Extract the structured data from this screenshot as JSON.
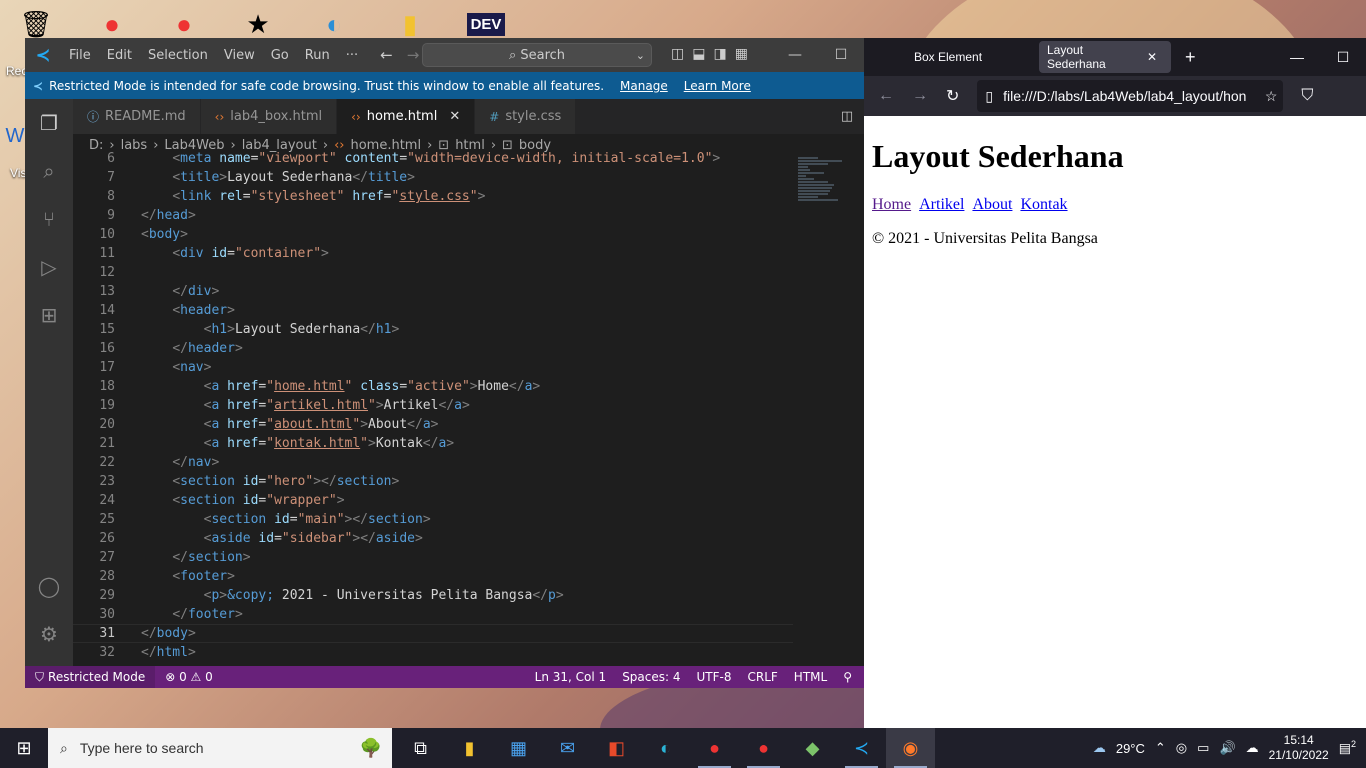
{
  "desktop": {
    "recycle_label": "Rec",
    "vs_label": "Vis"
  },
  "vscode": {
    "menu": [
      "File",
      "Edit",
      "Selection",
      "View",
      "Go",
      "Run",
      "···"
    ],
    "search_placeholder": "Search",
    "banner_text": "Restricted Mode is intended for safe code browsing. Trust this window to enable all features.",
    "banner_manage": "Manage",
    "banner_learn": "Learn More",
    "tabs": [
      {
        "label": "README.md",
        "icon": "info-icon"
      },
      {
        "label": "lab4_box.html",
        "icon": "html-icon"
      },
      {
        "label": "home.html",
        "icon": "html-icon",
        "active": true
      },
      {
        "label": "style.css",
        "icon": "css-icon"
      }
    ],
    "breadcrumb": [
      "D:",
      "labs",
      "Lab4Web",
      "lab4_layout",
      "home.html",
      "html",
      "body"
    ],
    "lines": [
      {
        "n": "6",
        "code": "    <meta name=\"viewport\" content=\"width=device-width, initial-scale=1.0\">"
      },
      {
        "n": "7",
        "code": "    <title>Layout Sederhana</title>"
      },
      {
        "n": "8",
        "code": "    <link rel=\"stylesheet\" href=\"style.css\">"
      },
      {
        "n": "9",
        "code": "</head>"
      },
      {
        "n": "10",
        "code": "<body>"
      },
      {
        "n": "11",
        "code": "    <div id=\"container\">"
      },
      {
        "n": "12",
        "code": ""
      },
      {
        "n": "13",
        "code": "    </div>"
      },
      {
        "n": "14",
        "code": "    <header>"
      },
      {
        "n": "15",
        "code": "        <h1>Layout Sederhana</h1>"
      },
      {
        "n": "16",
        "code": "    </header>"
      },
      {
        "n": "17",
        "code": "    <nav>"
      },
      {
        "n": "18",
        "code": "        <a href=\"home.html\" class=\"active\">Home</a>"
      },
      {
        "n": "19",
        "code": "        <a href=\"artikel.html\">Artikel</a>"
      },
      {
        "n": "20",
        "code": "        <a href=\"about.html\">About</a>"
      },
      {
        "n": "21",
        "code": "        <a href=\"kontak.html\">Kontak</a>"
      },
      {
        "n": "22",
        "code": "    </nav>"
      },
      {
        "n": "23",
        "code": "    <section id=\"hero\"></section>"
      },
      {
        "n": "24",
        "code": "    <section id=\"wrapper\">"
      },
      {
        "n": "25",
        "code": "        <section id=\"main\"></section>"
      },
      {
        "n": "26",
        "code": "        <aside id=\"sidebar\"></aside>"
      },
      {
        "n": "27",
        "code": "    </section>"
      },
      {
        "n": "28",
        "code": "    <footer>"
      },
      {
        "n": "29",
        "code": "        <p>&copy; 2021 - Universitas Pelita Bangsa</p>"
      },
      {
        "n": "30",
        "code": "    </footer>"
      },
      {
        "n": "31",
        "code": "</body>",
        "current": true
      },
      {
        "n": "32",
        "code": "</html>"
      }
    ],
    "status": {
      "mode": "Restricted Mode",
      "errors": "⊗ 0 ⚠ 0",
      "position": "Ln 31, Col 1",
      "spaces": "Spaces: 4",
      "encoding": "UTF-8",
      "eol": "CRLF",
      "language": "HTML"
    }
  },
  "firefox": {
    "tab_inactive": "Box Element",
    "tab_active": "Layout Sederhana",
    "url": "file:///D:/labs/Lab4Web/lab4_layout/hon",
    "page": {
      "heading": "Layout Sederhana",
      "nav": [
        "Home",
        "Artikel",
        "About",
        "Kontak"
      ],
      "footer": "© 2021 - Universitas Pelita Bangsa"
    }
  },
  "taskbar": {
    "search_placeholder": "Type here to search",
    "weather": "29°C",
    "time": "15:14",
    "date": "21/10/2022",
    "notification_count": "2"
  }
}
